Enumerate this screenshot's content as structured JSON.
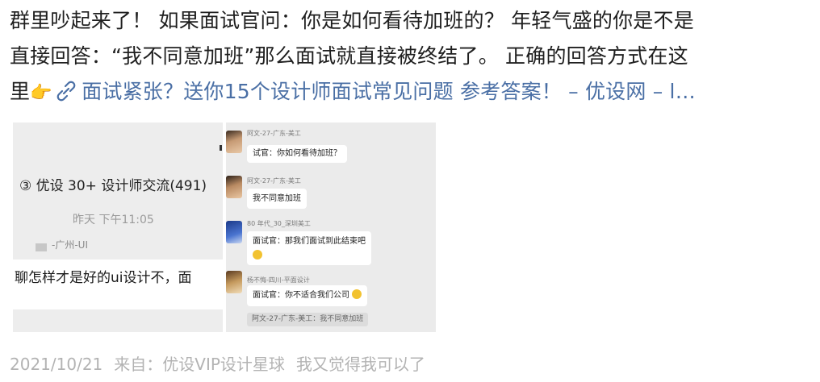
{
  "post": {
    "line1": "群里吵起来了！ 如果面试官问：你是如何看待加班的？ 年轻气盛的你是不是",
    "line2": "直接回答：“我不同意加班”那么面试就直接被终结了。 正确的回答方式在这",
    "line3_prefix": "里",
    "emoji": "👉",
    "link_text": "面试紧张？送你15个设计师面试常见问题 参考答案！ – 优设网 – l…"
  },
  "card": {
    "left": {
      "group_title": "③ 优设 30+ 设计师交流(491)",
      "time": "昨天 下午11:05",
      "sender": "-广州-UI",
      "message": "聊怎样才是好的ui设计不，面"
    },
    "right": {
      "messages": [
        {
          "name": "阿文-27-广东-美工",
          "text": "试官：你如何看待加班？"
        },
        {
          "name": "阿文-27-广东-美工",
          "text": "我不同意加班"
        },
        {
          "name": "80 年代_30_深圳美工",
          "text": "面试官：那我们面试到此结束吧"
        },
        {
          "name": "杨不悔-四川-平面设计",
          "text": "面试官：你不适合我们公司"
        }
      ],
      "footer": "阿文-27-广东-美工：我不同意加班"
    }
  },
  "meta": {
    "date": "2021/10/21",
    "source": "来自：优设VIP设计星球",
    "comment": "我又觉得我可以了"
  },
  "colors": {
    "link": "#4a6fa5",
    "meta": "#b3b3b3"
  }
}
